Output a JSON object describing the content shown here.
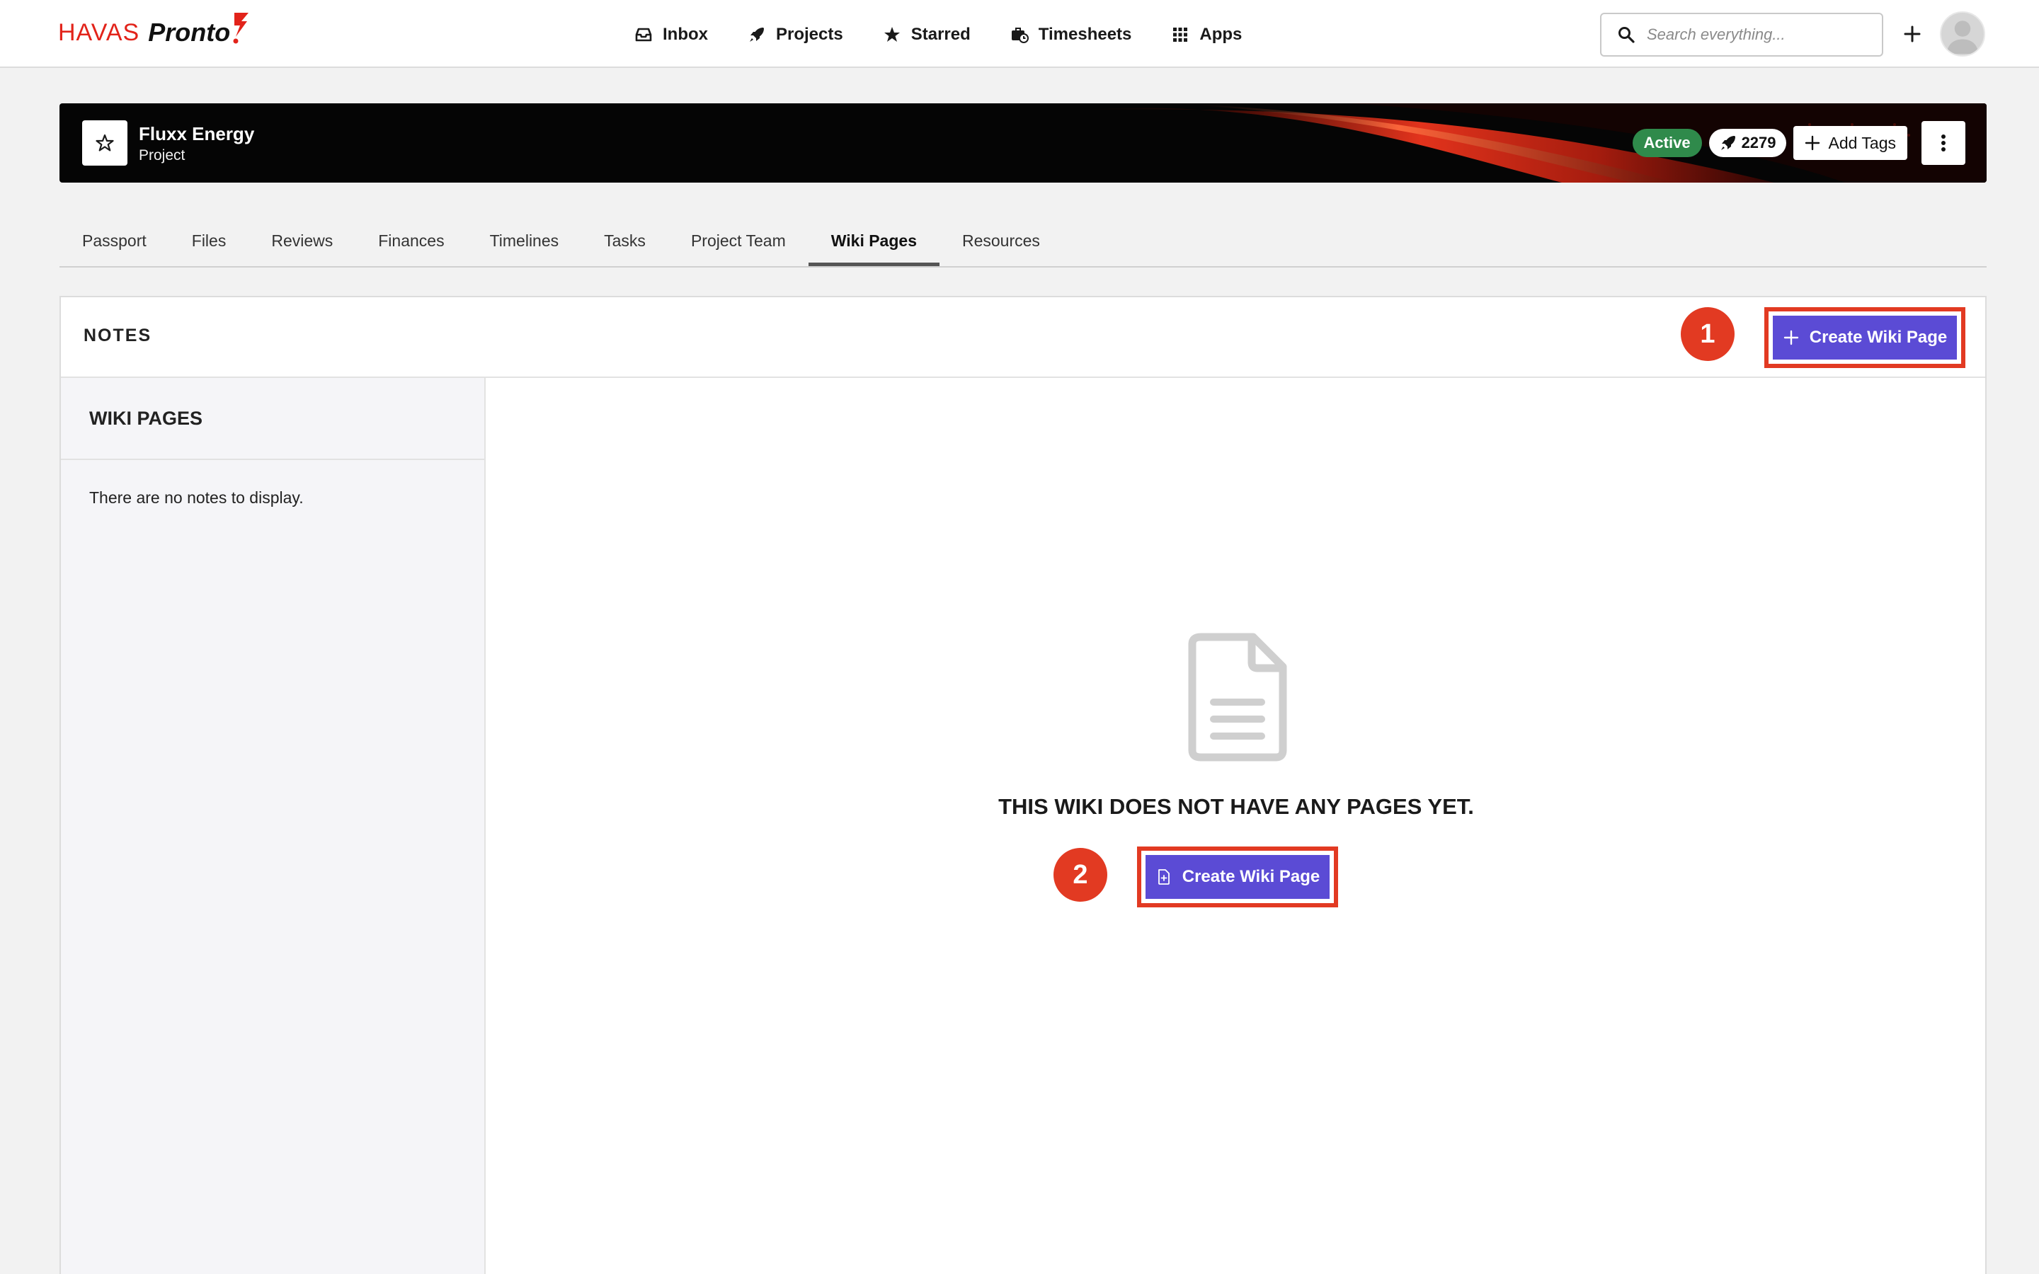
{
  "brand": {
    "havas": "HAVAS",
    "pronto": "Pronto",
    "accent": "#e2231a"
  },
  "nav": {
    "items": [
      {
        "label": "Inbox",
        "icon": "inbox-icon"
      },
      {
        "label": "Projects",
        "icon": "rocket-icon"
      },
      {
        "label": "Starred",
        "icon": "star-icon"
      },
      {
        "label": "Timesheets",
        "icon": "timesheet-icon"
      },
      {
        "label": "Apps",
        "icon": "grid-icon"
      }
    ],
    "search_placeholder": "Search everything..."
  },
  "project": {
    "name": "Fluxx Energy",
    "type": "Project",
    "status": "Active",
    "status_color": "#2f8a4b",
    "count": "2279",
    "add_tags_label": "Add Tags"
  },
  "tabs": {
    "items": [
      "Passport",
      "Files",
      "Reviews",
      "Finances",
      "Timelines",
      "Tasks",
      "Project Team",
      "Wiki Pages",
      "Resources"
    ],
    "active": "Wiki Pages"
  },
  "notes": {
    "title": "NOTES",
    "create_button_label": "Create Wiki Page",
    "sidebar_title": "WIKI PAGES",
    "sidebar_empty": "There are no notes to display.",
    "empty_message": "THIS WIKI DOES NOT HAVE ANY PAGES YET.",
    "empty_button_label": "Create Wiki Page",
    "button_color": "#5b4bd5"
  },
  "callouts": {
    "first": "1",
    "second": "2",
    "color": "#e23a22"
  }
}
